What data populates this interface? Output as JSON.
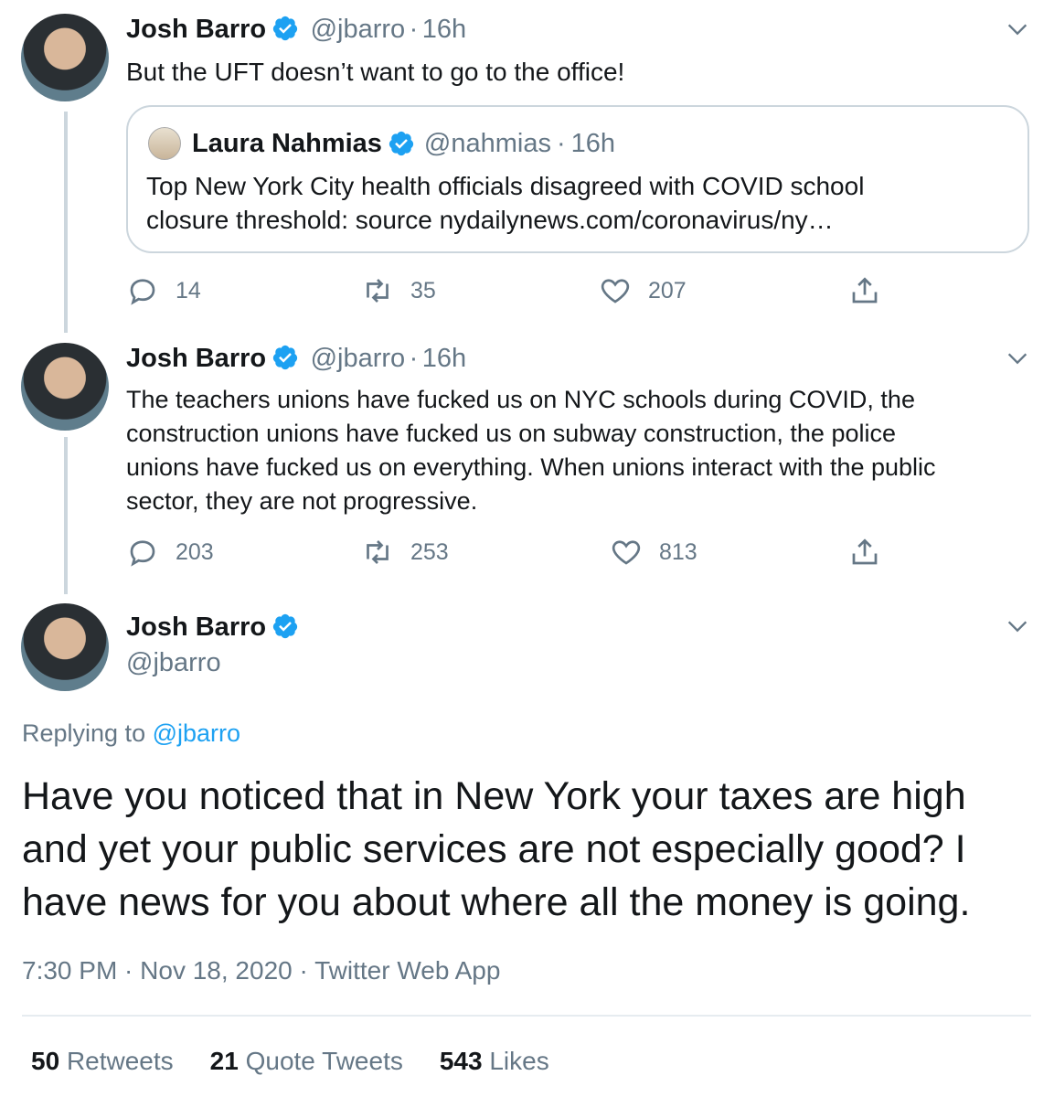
{
  "tweet1": {
    "name": "Josh Barro",
    "handle": "@jbarro",
    "time": "16h",
    "text": "But the UFT doesn’t want to go to the office!",
    "quote": {
      "name": "Laura Nahmias",
      "handle": "@nahmias",
      "time": "16h",
      "text_line1": "Top New York City health officials disagreed with COVID school",
      "text_line2": "closure threshold: source nydailynews.com/coronavirus/ny…"
    },
    "replies": "14",
    "retweets": "35",
    "likes": "207"
  },
  "tweet2": {
    "name": "Josh Barro",
    "handle": "@jbarro",
    "time": "16h",
    "line1": "The teachers unions have fucked us on NYC schools during COVID, the",
    "line2": "construction unions have fucked us on subway construction, the police",
    "line3": "unions have fucked us on everything. When unions interact with the public",
    "line4": "sector, they are not progressive.",
    "replies": "203",
    "retweets": "253",
    "likes": "813"
  },
  "main": {
    "name": "Josh Barro",
    "handle": "@jbarro",
    "replying_prefix": "Replying to",
    "replying_handle": "@jbarro",
    "line1": "Have you noticed that in New York your taxes are high",
    "line2": "and yet your public services are not especially good? I",
    "line3": "have news for you about where all the money is going.",
    "timestamp": "7:30 PM · Nov 18, 2020 · Twitter Web App",
    "retweets_count": "50",
    "retweets_label": "Retweets",
    "quotes_count": "21",
    "quotes_label": "Quote Tweets",
    "likes_count": "543",
    "likes_label": "Likes"
  },
  "colors": {
    "accent": "#1da1f2",
    "secondary_text": "#657786",
    "border": "#ccd6dd"
  }
}
